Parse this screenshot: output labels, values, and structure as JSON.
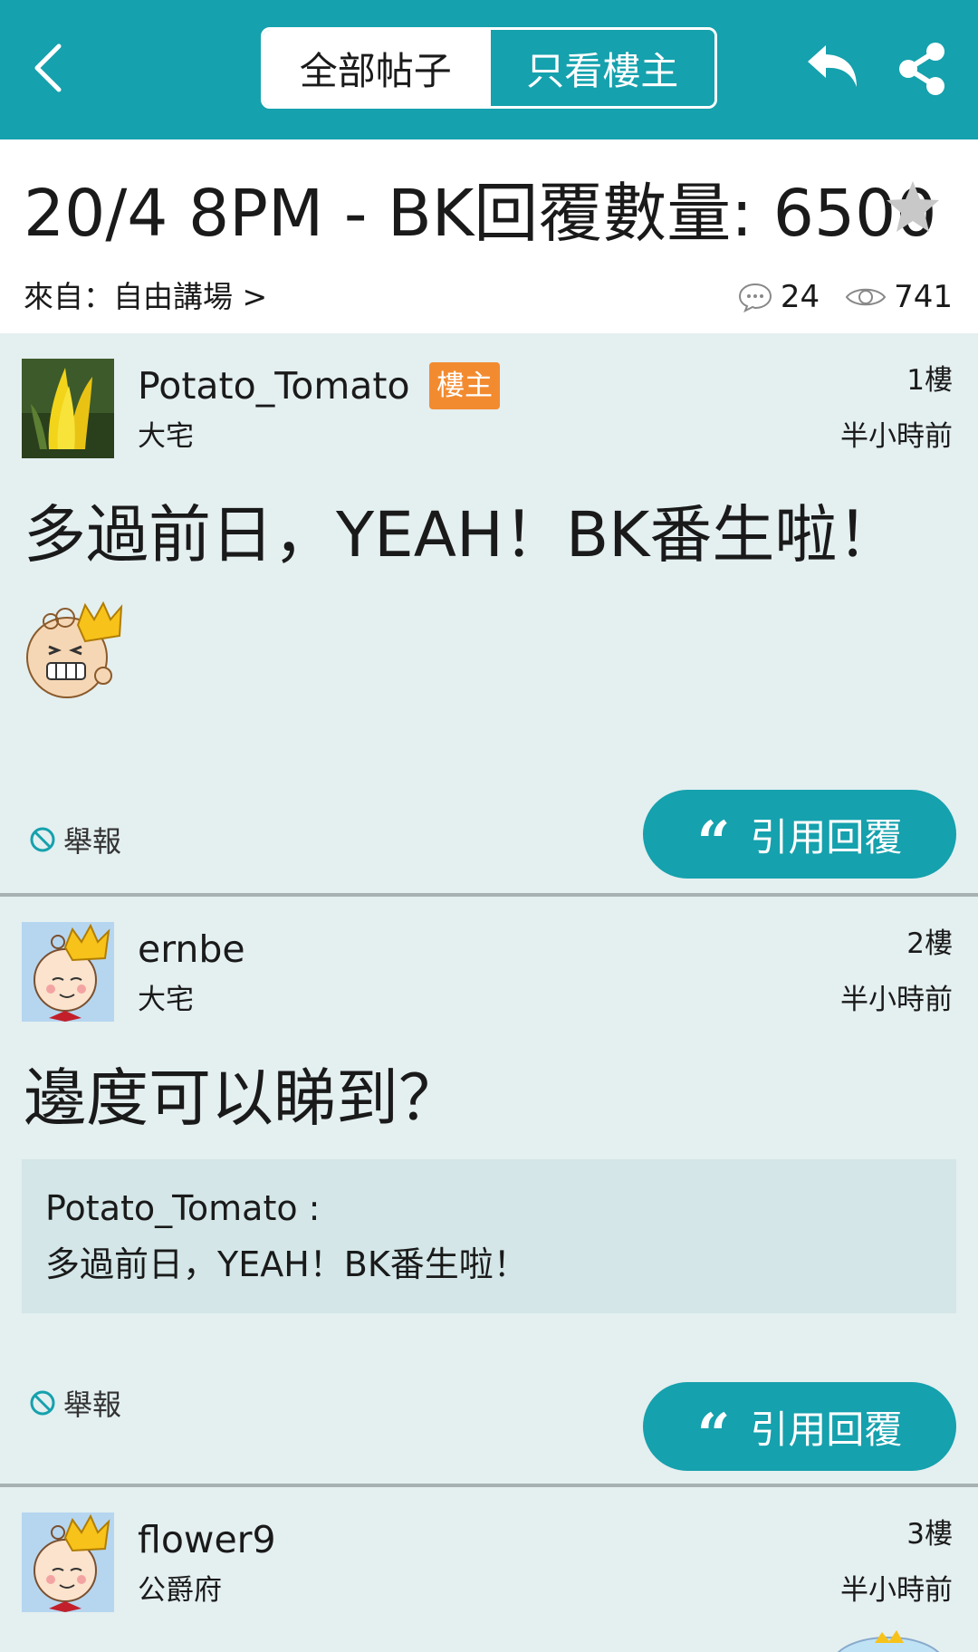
{
  "nav": {
    "tabs": [
      {
        "label": "全部帖子",
        "active": false
      },
      {
        "label": "只看樓主",
        "active": true
      }
    ],
    "accent_color": "#15a1ad",
    "icons": [
      "back-icon",
      "reply-icon",
      "share-icon"
    ]
  },
  "thread": {
    "title": "20/4 8PM - BK回覆數量: 6500",
    "from_label": "來自：自由講場 >",
    "reply_count": "24",
    "view_count": "741"
  },
  "posts": [
    {
      "username": "Potato_Tomato",
      "badge": "樓主",
      "rank": "大宅",
      "floor": "1樓",
      "time": "半小時前",
      "content": "多過前日，YEAH！BK番生啦！",
      "report_label": "舉報",
      "quote_label": "引用回覆"
    },
    {
      "username": "ernbe",
      "rank": "大宅",
      "floor": "2樓",
      "time": "半小時前",
      "content": "邊度可以睇到？",
      "quote_author": "Potato_Tomato :",
      "quote_text": "多過前日，YEAH！BK番生啦！",
      "report_label": "舉報",
      "quote_label": "引用回覆"
    },
    {
      "username": "flower9",
      "rank": "公爵府",
      "floor": "3樓",
      "time": "半小時前"
    }
  ]
}
